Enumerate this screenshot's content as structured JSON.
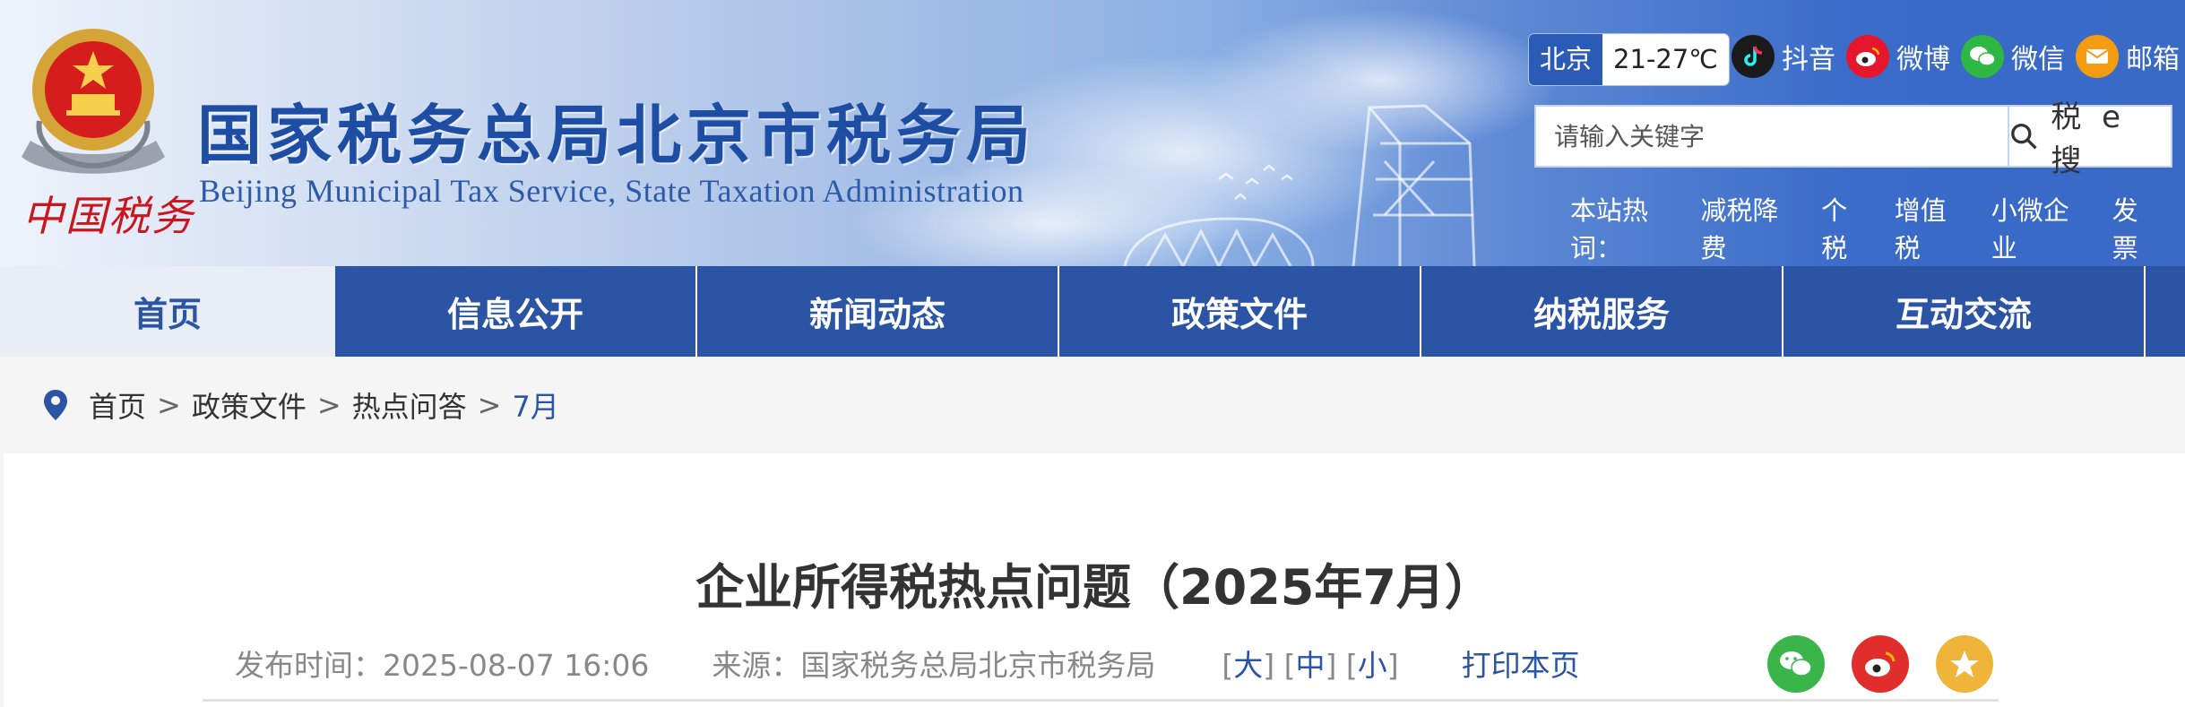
{
  "header": {
    "emblem_text": "中国税务",
    "title": "国家税务总局北京市税务局",
    "subtitle": "Beijing Municipal Tax Service, State Taxation Administration",
    "weather": {
      "city": "北京",
      "temp": "21-27℃"
    },
    "social": [
      {
        "name": "douyin",
        "label": "抖音",
        "color": "#1a1a1a"
      },
      {
        "name": "weibo",
        "label": "微博",
        "color": "#e6162d"
      },
      {
        "name": "wechat",
        "label": "微信",
        "color": "#2fb743"
      },
      {
        "name": "email",
        "label": "邮箱",
        "color": "#f39c12"
      }
    ],
    "search": {
      "placeholder": "请输入关键字",
      "button": "税 e 搜"
    },
    "hotwords": {
      "label": "本站热词：",
      "items": [
        "减税降费",
        "个税",
        "增值税",
        "小微企业",
        "发票"
      ]
    }
  },
  "nav": {
    "items": [
      "首页",
      "信息公开",
      "新闻动态",
      "政策文件",
      "纳税服务",
      "互动交流"
    ]
  },
  "breadcrumb": {
    "items": [
      "首页",
      "政策文件",
      "热点问答"
    ],
    "current": "7月",
    "separator": ">"
  },
  "article": {
    "title": "企业所得税热点问题（2025年7月）",
    "publish_time": "发布时间：2025-08-07 16:06",
    "source": "来源：国家税务总局北京市税务局",
    "font_sizes": {
      "open": "[",
      "large": "大",
      "medium": "中",
      "small": "小",
      "close": "]"
    },
    "print": "打印本页"
  },
  "share": [
    {
      "name": "wechat",
      "color": "#3ab54a"
    },
    {
      "name": "weibo",
      "color": "#e22d2d"
    },
    {
      "name": "favorite",
      "color": "#f0b43a"
    }
  ]
}
